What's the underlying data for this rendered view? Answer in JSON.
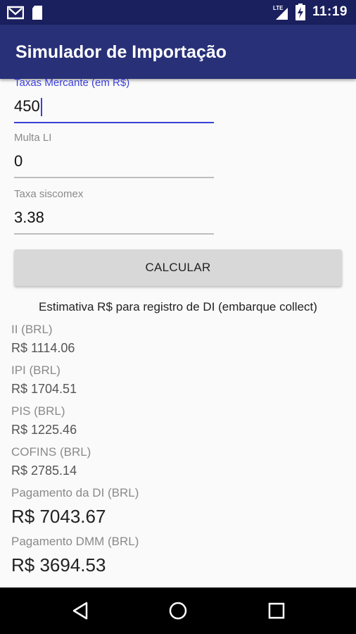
{
  "status_bar": {
    "time": "11:19",
    "network": "LTE",
    "left_icons": [
      "gmail-icon",
      "sd-card-icon"
    ],
    "right_icons": [
      "lte-signal-icon",
      "battery-charging-icon"
    ]
  },
  "app_bar": {
    "title": "Simulador de Importação",
    "color": "#283077"
  },
  "form": {
    "fields": [
      {
        "label": "Taxas Mercante (em R$)",
        "value": "450",
        "focused": true
      },
      {
        "label": "Multa LI",
        "value": "0",
        "focused": false
      },
      {
        "label": "Taxa siscomex",
        "value": "3.38",
        "focused": false
      }
    ],
    "calculate_button": "CALCULAR",
    "accent_color": "#3b3fd8"
  },
  "results": {
    "title": "Estimativa R$ para registro de DI (embarque collect)",
    "items": [
      {
        "label": "II (BRL)",
        "value": "R$ 1114.06"
      },
      {
        "label": "IPI (BRL)",
        "value": "R$ 1704.51"
      },
      {
        "label": "PIS (BRL)",
        "value": "R$ 1225.46"
      },
      {
        "label": "COFINS (BRL)",
        "value": "R$ 2785.14"
      },
      {
        "label": "Pagamento da DI (BRL)",
        "value": "R$ 7043.67"
      },
      {
        "label": "Pagamento DMM (BRL)",
        "value": "R$ 3694.53"
      }
    ]
  },
  "nav_bar": {
    "buttons": [
      "back-icon",
      "home-icon",
      "recents-icon"
    ]
  }
}
